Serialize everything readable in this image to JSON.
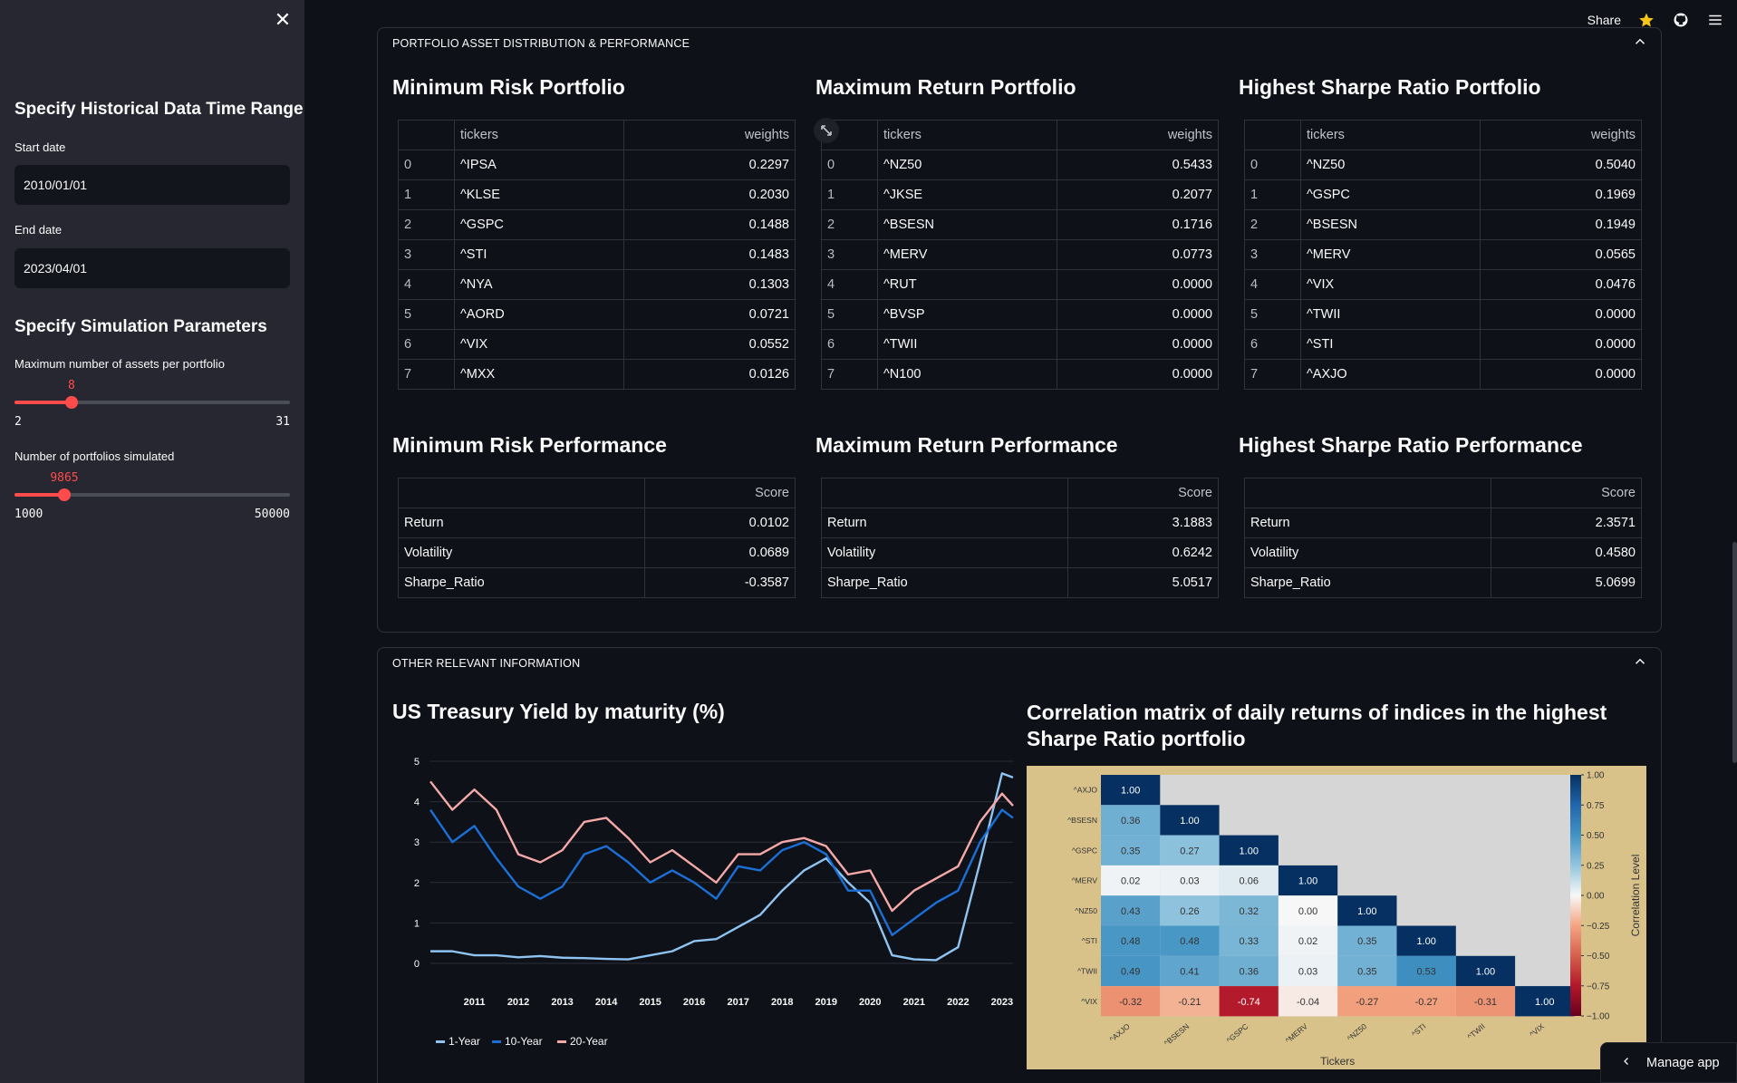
{
  "sidebar": {
    "section1_title": "Specify Historical Data Time Range",
    "start_label": "Start date",
    "start_value": "2010/01/01",
    "end_label": "End date",
    "end_value": "2023/04/01",
    "section2_title": "Specify Simulation Parameters",
    "assets_label": "Maximum number of assets per portfolio",
    "assets_slider": {
      "value": 8,
      "min": 2,
      "max": 31
    },
    "portfolios_label": "Number of portfolios simulated",
    "portfolios_slider": {
      "value": 9865,
      "min": 1000,
      "max": 50000
    }
  },
  "header": {
    "share_label": "Share"
  },
  "expander1": {
    "title": "PORTFOLIO ASSET DISTRIBUTION & PERFORMANCE"
  },
  "expander2": {
    "title": "OTHER RELEVANT INFORMATION"
  },
  "manage_app_label": "Manage app",
  "portfolios": [
    {
      "title": "Minimum Risk Portfolio",
      "headers": [
        "",
        "tickers",
        "weights"
      ],
      "rows": [
        [
          "0",
          "^IPSA",
          "0.2297"
        ],
        [
          "1",
          "^KLSE",
          "0.2030"
        ],
        [
          "2",
          "^GSPC",
          "0.1488"
        ],
        [
          "3",
          "^STI",
          "0.1483"
        ],
        [
          "4",
          "^NYA",
          "0.1303"
        ],
        [
          "5",
          "^AORD",
          "0.0721"
        ],
        [
          "6",
          "^VIX",
          "0.0552"
        ],
        [
          "7",
          "^MXX",
          "0.0126"
        ]
      ],
      "perf_title": "Minimum Risk Performance",
      "perf_header": "Score",
      "perf_rows": [
        [
          "Return",
          "0.0102"
        ],
        [
          "Volatility",
          "0.0689"
        ],
        [
          "Sharpe_Ratio",
          "-0.3587"
        ]
      ]
    },
    {
      "title": "Maximum Return Portfolio",
      "headers": [
        "",
        "tickers",
        "weights"
      ],
      "rows": [
        [
          "0",
          "^NZ50",
          "0.5433"
        ],
        [
          "1",
          "^JKSE",
          "0.2077"
        ],
        [
          "2",
          "^BSESN",
          "0.1716"
        ],
        [
          "3",
          "^MERV",
          "0.0773"
        ],
        [
          "4",
          "^RUT",
          "0.0000"
        ],
        [
          "5",
          "^BVSP",
          "0.0000"
        ],
        [
          "6",
          "^TWII",
          "0.0000"
        ],
        [
          "7",
          "^N100",
          "0.0000"
        ]
      ],
      "perf_title": "Maximum Return Performance",
      "perf_header": "Score",
      "perf_rows": [
        [
          "Return",
          "3.1883"
        ],
        [
          "Volatility",
          "0.6242"
        ],
        [
          "Sharpe_Ratio",
          "5.0517"
        ]
      ]
    },
    {
      "title": "Highest Sharpe Ratio Portfolio",
      "headers": [
        "",
        "tickers",
        "weights"
      ],
      "rows": [
        [
          "0",
          "^NZ50",
          "0.5040"
        ],
        [
          "1",
          "^GSPC",
          "0.1969"
        ],
        [
          "2",
          "^BSESN",
          "0.1949"
        ],
        [
          "3",
          "^MERV",
          "0.0565"
        ],
        [
          "4",
          "^VIX",
          "0.0476"
        ],
        [
          "5",
          "^TWII",
          "0.0000"
        ],
        [
          "6",
          "^STI",
          "0.0000"
        ],
        [
          "7",
          "^AXJO",
          "0.0000"
        ]
      ],
      "perf_title": "Highest Sharpe Ratio Performance",
      "perf_header": "Score",
      "perf_rows": [
        [
          "Return",
          "2.3571"
        ],
        [
          "Volatility",
          "0.4580"
        ],
        [
          "Sharpe_Ratio",
          "5.0699"
        ]
      ]
    }
  ],
  "treasury": {
    "title": "US Treasury Yield by maturity (%)"
  },
  "correlation": {
    "title": "Correlation matrix of daily returns of indices in the highest Sharpe Ratio portfolio"
  },
  "colors": {
    "accent": "#ff4b4b",
    "bg": "#0e1117",
    "sidebar": "#262730",
    "y1": "#8fc4f2",
    "y10": "#1b6fd6",
    "y20": "#f4a9a8",
    "heatmap_bg": "#d8c28a"
  },
  "chart_data": [
    {
      "type": "line",
      "x": [
        "2010",
        "2010.5",
        "2011",
        "2011.5",
        "2012",
        "2012.5",
        "2013",
        "2013.5",
        "2014",
        "2014.5",
        "2015",
        "2015.5",
        "2016",
        "2016.5",
        "2017",
        "2017.5",
        "2018",
        "2018.5",
        "2019",
        "2019.5",
        "2020",
        "2020.5",
        "2021",
        "2021.5",
        "2022",
        "2022.5",
        "2023",
        "2023.25"
      ],
      "series": [
        {
          "name": "1-Year",
          "color": "#8fc4f2",
          "values": [
            0.3,
            0.3,
            0.2,
            0.2,
            0.15,
            0.18,
            0.14,
            0.13,
            0.11,
            0.1,
            0.2,
            0.3,
            0.55,
            0.6,
            0.9,
            1.2,
            1.8,
            2.3,
            2.6,
            2.0,
            1.5,
            0.2,
            0.1,
            0.08,
            0.4,
            2.5,
            4.7,
            4.6
          ]
        },
        {
          "name": "10-Year",
          "color": "#1b6fd6",
          "values": [
            3.8,
            3.0,
            3.4,
            2.6,
            1.9,
            1.6,
            1.9,
            2.7,
            2.9,
            2.5,
            2.0,
            2.3,
            2.0,
            1.6,
            2.4,
            2.3,
            2.8,
            3.0,
            2.7,
            1.8,
            1.8,
            0.7,
            1.1,
            1.5,
            1.8,
            3.0,
            3.8,
            3.6
          ]
        },
        {
          "name": "20-Year",
          "color": "#f4a9a8",
          "values": [
            4.5,
            3.8,
            4.3,
            3.8,
            2.7,
            2.5,
            2.8,
            3.5,
            3.6,
            3.1,
            2.5,
            2.8,
            2.4,
            2.0,
            2.7,
            2.7,
            3.0,
            3.1,
            2.9,
            2.2,
            2.3,
            1.3,
            1.8,
            2.1,
            2.4,
            3.5,
            4.2,
            3.9
          ]
        }
      ],
      "xticks": [
        "2011",
        "2012",
        "2013",
        "2014",
        "2015",
        "2016",
        "2017",
        "2018",
        "2019",
        "2020",
        "2021",
        "2022",
        "2023"
      ],
      "yticks": [
        "0",
        "1",
        "2",
        "3",
        "4",
        "5"
      ],
      "ylim": [
        0,
        5
      ]
    },
    {
      "type": "heatmap",
      "labels": [
        "^AXJO",
        "^BSESN",
        "^GSPC",
        "^MERV",
        "^NZ50",
        "^STI",
        "^TWII",
        "^VIX"
      ],
      "matrix": [
        [
          1.0
        ],
        [
          0.36,
          1.0
        ],
        [
          0.35,
          0.27,
          1.0
        ],
        [
          0.02,
          0.03,
          0.06,
          1.0
        ],
        [
          0.43,
          0.26,
          0.32,
          0.0,
          1.0
        ],
        [
          0.48,
          0.48,
          0.33,
          0.02,
          0.35,
          1.0
        ],
        [
          0.49,
          0.41,
          0.36,
          0.03,
          0.35,
          0.53,
          1.0
        ],
        [
          -0.32,
          -0.21,
          -0.74,
          -0.04,
          -0.27,
          -0.27,
          -0.31,
          1.0
        ]
      ],
      "cells": [
        [
          "1.00"
        ],
        [
          "0.36",
          "1.00"
        ],
        [
          "0.35",
          "0.27",
          "1.00"
        ],
        [
          "0.02",
          "0.03",
          "0.06",
          "1.00"
        ],
        [
          "0.43",
          "0.26",
          "0.32",
          "0.00",
          "1.00"
        ],
        [
          "0.48",
          "0.48",
          "0.33",
          "0.02",
          "0.35",
          "1.00"
        ],
        [
          "0.49",
          "0.41",
          "0.36",
          "0.03",
          "0.35",
          "0.53",
          "1.00"
        ],
        [
          "-0.32",
          "-0.21",
          "-0.74",
          "-0.04",
          "-0.27",
          "-0.27",
          "-0.31",
          "1.00"
        ]
      ],
      "xlabel": "Tickers",
      "colorbar_label": "Correlation Level",
      "colorbar_ticks": [
        "1.00",
        "0.75",
        "0.50",
        "0.25",
        "0.00",
        "−0.25",
        "−0.50",
        "−0.75",
        "−1.00"
      ],
      "vmin": -1,
      "vmax": 1
    }
  ]
}
